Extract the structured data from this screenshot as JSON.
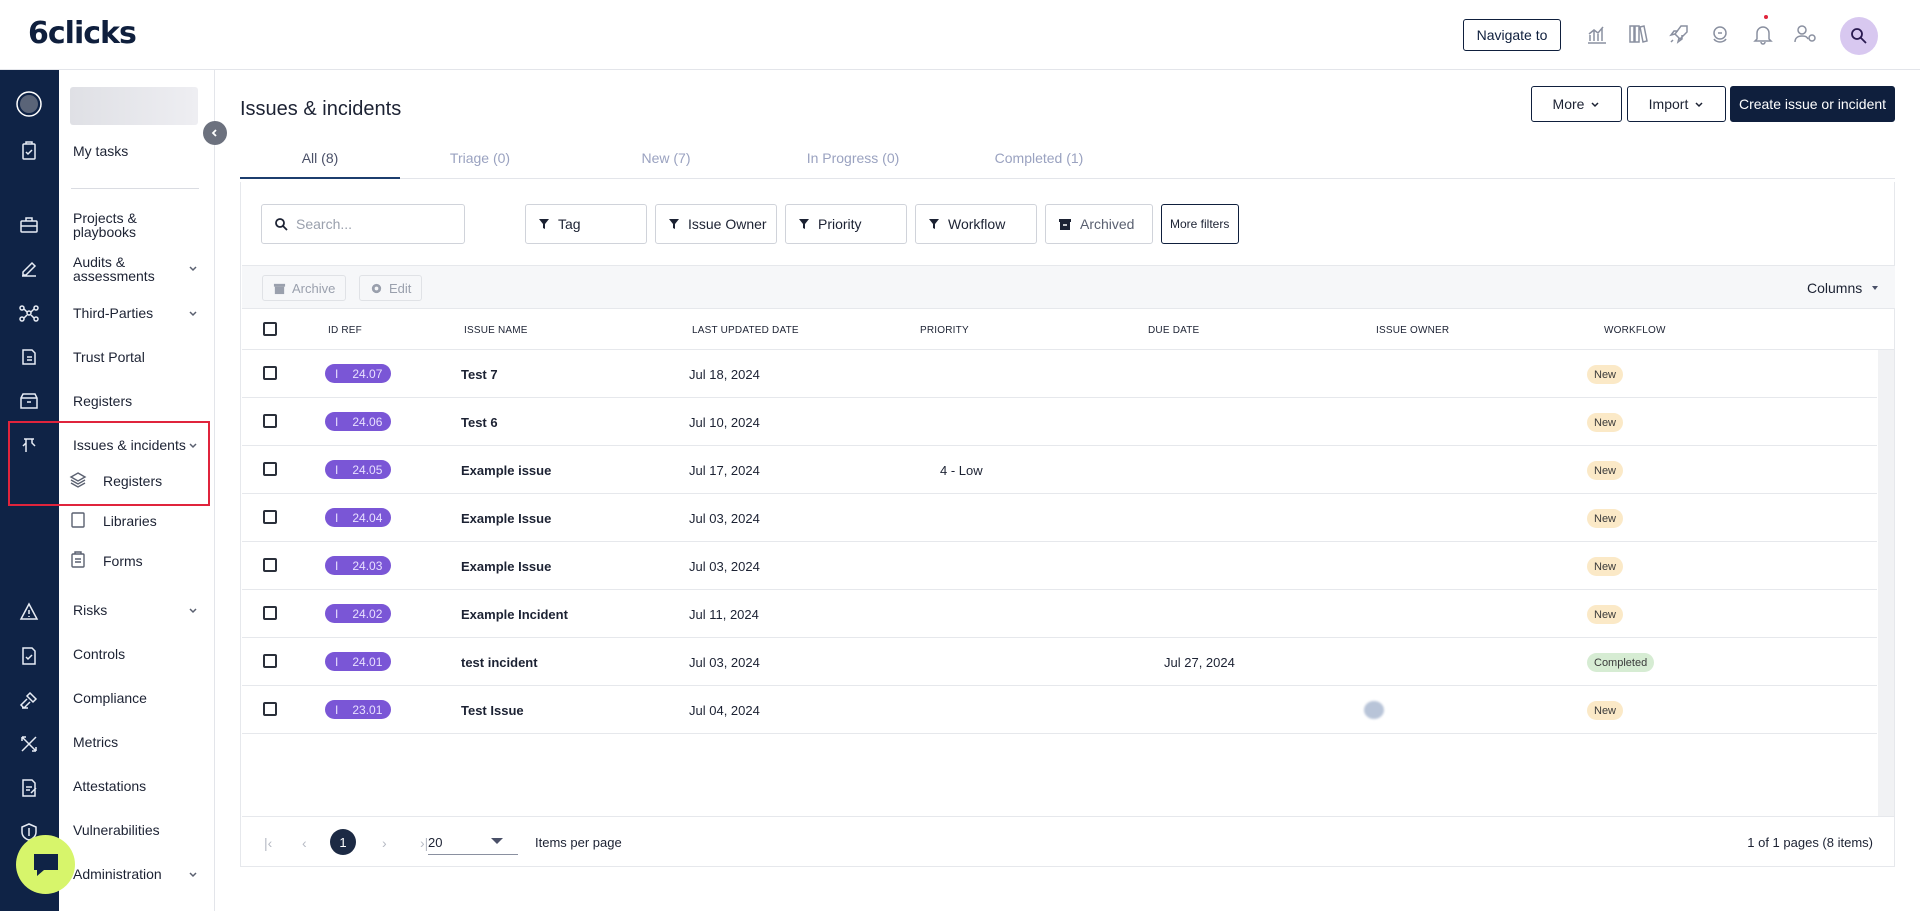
{
  "app": {
    "logo": "6clicks",
    "navigate_label": "Navigate to"
  },
  "topbar_icons": [
    "analytics-icon",
    "library-icon",
    "rocket-icon",
    "support-icon",
    "bell-icon",
    "user-settings-icon",
    "avatar-search-icon"
  ],
  "sidebar": {
    "my_tasks": "My tasks",
    "items": [
      {
        "label": "Projects & playbooks"
      },
      {
        "label": "Audits & assessments"
      },
      {
        "label": "Third-Parties"
      },
      {
        "label": "Trust Portal"
      },
      {
        "label": "Registers"
      },
      {
        "label": "Issues & incidents"
      },
      {
        "label": "Risks"
      },
      {
        "label": "Controls"
      },
      {
        "label": "Compliance"
      },
      {
        "label": "Metrics"
      },
      {
        "label": "Attestations"
      },
      {
        "label": "Vulnerabilities"
      },
      {
        "label": "Administration"
      }
    ],
    "sub_items": [
      {
        "label": "Registers",
        "icon": "layers-icon"
      },
      {
        "label": "Libraries",
        "icon": "book-icon"
      },
      {
        "label": "Forms",
        "icon": "clipboard-icon"
      }
    ]
  },
  "page": {
    "title": "Issues & incidents",
    "more_label": "More",
    "import_label": "Import",
    "create_label": "Create issue or incident"
  },
  "tabs": [
    "All (8)",
    "Triage (0)",
    "New (7)",
    "In Progress (0)",
    "Completed (1)"
  ],
  "filters": {
    "search_placeholder": "Search...",
    "tag": "Tag",
    "issue_owner": "Issue Owner",
    "priority": "Priority",
    "workflow": "Workflow",
    "archived": "Archived",
    "more_filters": "More filters"
  },
  "toolbar": {
    "archive": "Archive",
    "edit": "Edit",
    "columns": "Columns"
  },
  "table": {
    "headers": [
      "ID REF",
      "ISSUE NAME",
      "LAST UPDATED DATE",
      "PRIORITY",
      "DUE DATE",
      "ISSUE OWNER",
      "WORKFLOW"
    ],
    "rows": [
      {
        "prefix": "I",
        "id": "24.07",
        "name": "Test 7",
        "updated": "Jul 18, 2024",
        "priority": "",
        "due": "",
        "owner": false,
        "workflow": "New",
        "status": "new"
      },
      {
        "prefix": "I",
        "id": "24.06",
        "name": "Test 6",
        "updated": "Jul 10, 2024",
        "priority": "",
        "due": "",
        "owner": false,
        "workflow": "New",
        "status": "new"
      },
      {
        "prefix": "I",
        "id": "24.05",
        "name": "Example issue",
        "updated": "Jul 17, 2024",
        "priority": "4 - Low",
        "due": "",
        "owner": false,
        "workflow": "New",
        "status": "new"
      },
      {
        "prefix": "I",
        "id": "24.04",
        "name": "Example Issue",
        "updated": "Jul 03, 2024",
        "priority": "",
        "due": "",
        "owner": false,
        "workflow": "New",
        "status": "new"
      },
      {
        "prefix": "I",
        "id": "24.03",
        "name": "Example Issue",
        "updated": "Jul 03, 2024",
        "priority": "",
        "due": "",
        "owner": false,
        "workflow": "New",
        "status": "new"
      },
      {
        "prefix": "I",
        "id": "24.02",
        "name": "Example Incident",
        "updated": "Jul 11, 2024",
        "priority": "",
        "due": "",
        "owner": false,
        "workflow": "New",
        "status": "new"
      },
      {
        "prefix": "I",
        "id": "24.01",
        "name": "test incident",
        "updated": "Jul 03, 2024",
        "priority": "",
        "due": "Jul 27, 2024",
        "owner": false,
        "workflow": "Completed",
        "status": "done"
      },
      {
        "prefix": "I",
        "id": "23.01",
        "name": "Test Issue",
        "updated": "Jul 04, 2024",
        "priority": "",
        "due": "",
        "owner": true,
        "workflow": "New",
        "status": "new"
      }
    ]
  },
  "pager": {
    "current": "1",
    "per_page": "20",
    "items_per_page": "Items per page",
    "info": "1 of 1 pages (8 items)"
  },
  "colors": {
    "rail": "#0f2346",
    "primary": "#0f1f3d",
    "badge": "#7a56d6",
    "highlight": "#e0243c",
    "chat": "#d7f56b"
  }
}
